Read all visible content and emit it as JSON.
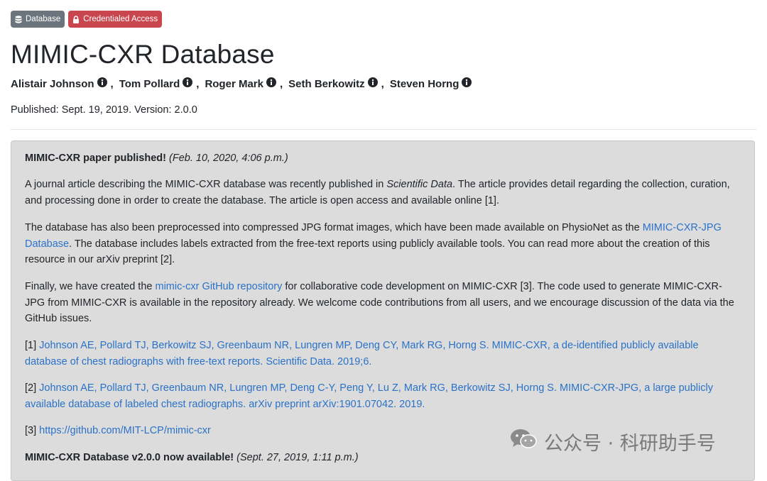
{
  "badges": {
    "database": "Database",
    "credentialed": "Credentialed Access"
  },
  "title": "MIMIC-CXR Database",
  "authors": [
    "Alistair Johnson",
    "Tom Pollard",
    "Roger Mark",
    "Seth Berkowitz",
    "Steven Horng"
  ],
  "author_separator": ",",
  "published": "Published: Sept. 19, 2019. Version: 2.0.0",
  "news": {
    "item1": {
      "headline": "MIMIC-CXR paper published!",
      "date": "(Feb. 10, 2020, 4:06 p.m.)",
      "p1_a": "A journal article describing the MIMIC-CXR database was recently published in ",
      "p1_em": "Scientific Data",
      "p1_b": ". The article provides detail regarding the collection, curation, and processing done in order to create the database. The article is open access and available online [1].",
      "p2_a": "The database has also been preprocessed into compressed JPG format images, which have been made available on PhysioNet as the ",
      "p2_link": "MIMIC-CXR-JPG Database",
      "p2_b": ". The database includes labels extracted from the free-text reports using publicly available tools. You can read more about the creation of this resource in our arXiv preprint [2].",
      "p3_a": "Finally, we have created the ",
      "p3_link": "mimic-cxr GitHub repository",
      "p3_b": " for collaborative code development on MIMIC-CXR [3]. The code used to generate MIMIC-CXR-JPG from MIMIC-CXR is available in the repository already. We welcome code contributions from all users, and we encourage discussion of the data via the GitHub issues.",
      "ref1_num": "[1] ",
      "ref1_link": "Johnson AE, Pollard TJ, Berkowitz SJ, Greenbaum NR, Lungren MP, Deng CY, Mark RG, Horng S. MIMIC-CXR, a de-identified publicly available database of chest radiographs with free-text reports. Scientific Data. 2019;6.",
      "ref2_num": "[2] ",
      "ref2_link": "Johnson AE, Pollard TJ, Greenbaum NR, Lungren MP, Deng C-Y, Peng Y, Lu Z, Mark RG, Berkowitz SJ, Horng S. MIMIC-CXR-JPG, a large publicly available database of labeled chest radiographs. arXiv preprint arXiv:1901.07042. 2019.",
      "ref3_num": "[3] ",
      "ref3_link": "https://github.com/MIT-LCP/mimic-cxr"
    },
    "item2": {
      "headline": "MIMIC-CXR Database v2.0.0 now available!",
      "date": "(Sept. 27, 2019, 1:11 p.m.)"
    }
  },
  "watermark": "公众号 · 科研助手号",
  "colors": {
    "link": "#2a72c8",
    "badge_database": "#6c757d",
    "badge_credentialed": "#c9464f",
    "news_background": "#dcdcdc"
  },
  "icons": {
    "database": "database-icon",
    "lock": "lock-icon",
    "info": "info-icon",
    "watermark": "wechat-icon"
  }
}
